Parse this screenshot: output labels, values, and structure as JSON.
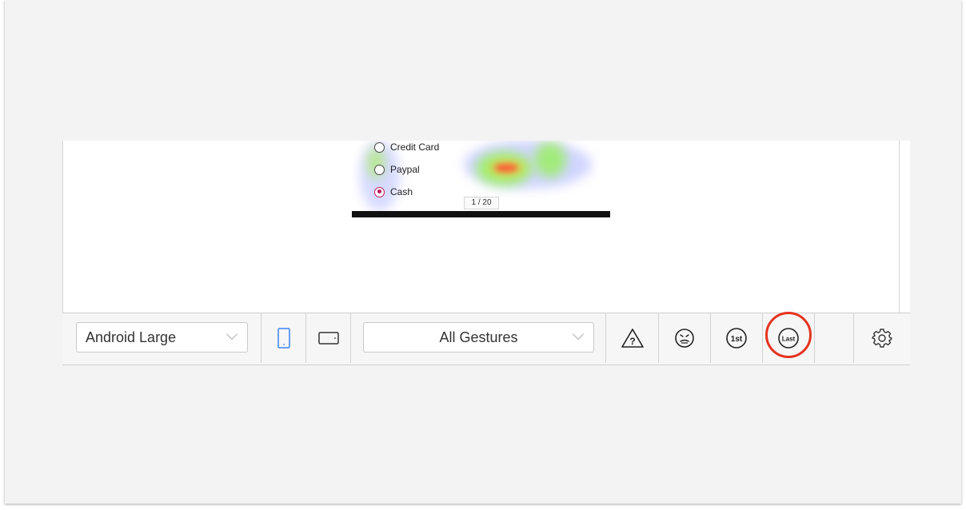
{
  "preview": {
    "options": [
      {
        "label": "Credit Card",
        "selected": false
      },
      {
        "label": "Paypal",
        "selected": false
      },
      {
        "label": "Cash",
        "selected": true
      }
    ],
    "page_indicator": "1 / 20"
  },
  "toolbar": {
    "device_select": {
      "value": "Android Large"
    },
    "orientation": {
      "portrait_icon": "phone-portrait-icon",
      "landscape_icon": "phone-landscape-icon",
      "active": "portrait",
      "active_color": "#3b82f6"
    },
    "gesture_select": {
      "value": "All Gestures"
    },
    "filters": [
      {
        "name": "warning-question-icon"
      },
      {
        "name": "frustrated-face-icon"
      },
      {
        "name": "first-interaction-icon",
        "label": "1st"
      },
      {
        "name": "last-interaction-icon",
        "label": "Last",
        "highlighted": true
      }
    ],
    "settings_icon": "gear-icon"
  },
  "colors": {
    "highlight": "#e53320",
    "selected_radio": "#c2185b"
  }
}
